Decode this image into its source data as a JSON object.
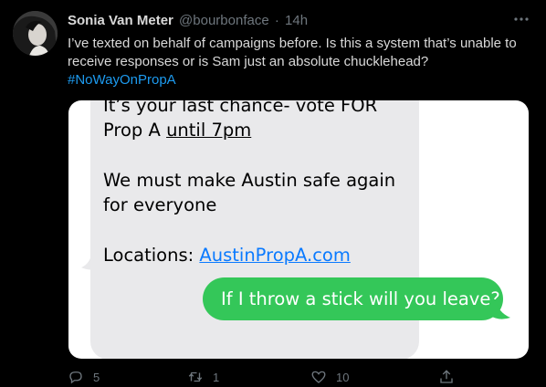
{
  "tweet": {
    "display_name": "Sonia Van Meter",
    "handle": "@bourbonface",
    "separator": "·",
    "time": "14h",
    "text_line1": "I’ve texted on behalf of campaigns before. Is this a system that’s unable to",
    "text_line2": "receive responses or is Sam just an absolute chucklehead?",
    "hashtag": "#NoWayOnPropA"
  },
  "screenshot": {
    "grey_line1": "It’s your last chance- vote FOR",
    "grey_line2_prefix": "Prop A ",
    "grey_line2_underlined": "until 7pm",
    "grey_line3": "We must make Austin safe again",
    "grey_line4": "for everyone",
    "grey_line5_prefix": "Locations: ",
    "grey_link": "AustinPropA.com",
    "green_message": "If I throw a stick will you leave?"
  },
  "actions": {
    "reply_count": "5",
    "retweet_count": "1",
    "like_count": "10"
  },
  "icons": {
    "more": "more-icon",
    "reply": "reply-icon",
    "retweet": "retweet-icon",
    "like": "heart-icon",
    "share": "share-icon"
  },
  "colors": {
    "background": "#000000",
    "text": "#d9d9d9",
    "secondary": "#6e767d",
    "link": "#1d9bf0",
    "imessage_green": "#34c759",
    "imessage_grey": "#e9e9eb",
    "sms_link": "#0a7aff"
  }
}
